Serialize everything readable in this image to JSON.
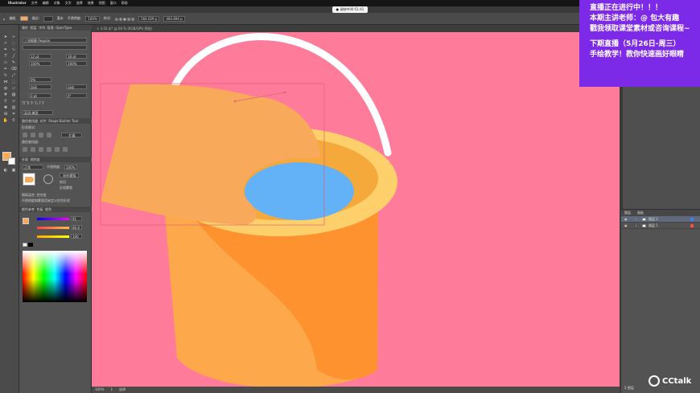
{
  "menubar": {
    "app_name": "Illustrator",
    "items": [
      "文件",
      "编辑",
      "对象",
      "文字",
      "选择",
      "效果",
      "视图",
      "窗口",
      "帮助"
    ],
    "status_time": "3384字",
    "status_right": [
      "2",
      "8",
      "8"
    ]
  },
  "recording_pill": "● 录制中00:51:41",
  "controlbar": {
    "mode_label": "编组",
    "stroke_label": "描边:",
    "stroke_value": "",
    "basic_label": "基本",
    "opacity_label": "不透明度:",
    "opacity_value": "100%",
    "style_label": "样式:",
    "x_value": "564.029 p",
    "y_value": "464.694 p"
  },
  "doc_tab": "× 3.02.ai* @ 66 % (RGB/GPU 预览)",
  "props": {
    "tab_props": "属性",
    "tab_layers": "图层",
    "tab_char": "字符",
    "tab_para": "段落",
    "tab_opentype": "OpenType",
    "font_name": "三流细圆 Regular",
    "font_size": "12 pt",
    "leading": "18 pt",
    "tracking": "100%",
    "scale": "100%",
    "kern": "0%",
    "auto_label": "自动",
    "auto_label2": "自动",
    "baseline": "0 pt",
    "rotate": "0°",
    "lang": "英语:美国",
    "tab_pathfinder": "路径查找器",
    "tab_align": "对齐",
    "tab_shapebuilder": "Shape Builder Tool",
    "shape_modes_label": "形状模式:",
    "expand_label": "扩展",
    "pathfinder_label": "路径查找器:",
    "tab_appearance": "外观",
    "tab_transparency": "透明度",
    "blend_mode": "正常",
    "opacity_label": "不透明度:",
    "opacity_value": "100%",
    "make_mask": "制作蒙版",
    "clip_label": "剪切",
    "invert_label": "反相蒙版",
    "isolate_blend": "隔离混合",
    "knockout_group": "挖空组",
    "opacity_mask_note": "不透明度和蒙版用来定义挖空形状",
    "tab_color_guide": "颜色参考",
    "tab_swatches": "色板",
    "tab_color": "颜色",
    "r_value": "91",
    "g_value": "86.8",
    "b_value": "100"
  },
  "statusbar": {
    "zoom": "100%",
    "artboard": "1",
    "tool_name": "选择"
  },
  "layers_panel": {
    "tab_layers": "图层",
    "tab_artboards": "画板",
    "rows": [
      {
        "name": "图层 2",
        "color": "#3f7bff",
        "selected": true
      },
      {
        "name": "图层 1",
        "color": "#ff4d4d",
        "selected": false
      }
    ],
    "footer": "2 图层"
  },
  "live_overlay": {
    "line1": "直播正在进行中！！！",
    "line2": "本期主讲老师：@ 包大有趣",
    "line3": "戳我领取课堂素材或咨询课程~",
    "line4": "下期直播（5月26日-周三）",
    "line5": "手绘教学！教你快速画好眼睛"
  },
  "watermark": "CCtalk",
  "colors": {
    "canvas_bg": "#fe7c9a",
    "bucket_body": "#fda84a",
    "bucket_shade": "#fd922f",
    "bucket_rim": "#fdd06c",
    "bucket_inner": "#f4a93a",
    "water": "#63b1f6",
    "cloth": "#f9a95a",
    "handle": "#ffffff",
    "live_bg": "#7c2ae8"
  }
}
